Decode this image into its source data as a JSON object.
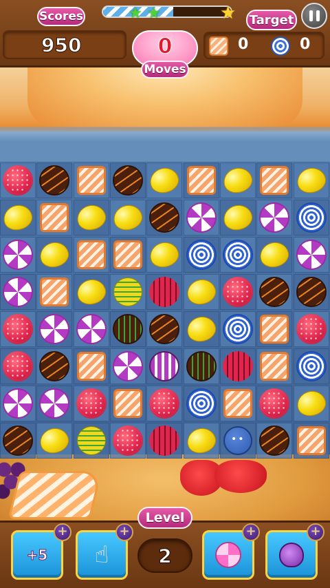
{
  "hud": {
    "scores_label": "Scores",
    "score_value": "950",
    "moves_value": "0",
    "moves_label": "Moves",
    "target_label": "Target",
    "progress_fraction": 0.55,
    "stars_earned": 2,
    "stars_total": 3,
    "targets": [
      {
        "icon": "toffee-candy-icon",
        "count": "0"
      },
      {
        "icon": "blue-swirl-candy-icon",
        "count": "0"
      }
    ]
  },
  "board": {
    "columns": 9,
    "empty_top_row": true,
    "grid": [
      [
        "raspberry",
        "chocolate",
        "toffee",
        "chocolate",
        "lemon",
        "toffee",
        "lemon",
        "toffee",
        "lemon"
      ],
      [
        "lemon",
        "toffee",
        "lemon",
        "lemon",
        "chocolate",
        "swirl",
        "lemon",
        "swirl",
        "blue"
      ],
      [
        "swirl",
        "lemon",
        "toffee",
        "toffee",
        "lemon",
        "blue",
        "blue",
        "lemon",
        "swirl"
      ],
      [
        "swirl",
        "toffee",
        "lemon",
        "lemon-striped",
        "raspberry-striped",
        "lemon",
        "raspberry",
        "chocolate",
        "chocolate"
      ],
      [
        "raspberry",
        "swirl",
        "swirl",
        "chocolate-striped",
        "chocolate",
        "lemon",
        "blue",
        "toffee",
        "raspberry"
      ],
      [
        "raspberry",
        "chocolate",
        "toffee",
        "swirl",
        "swirl-striped",
        "chocolate-striped",
        "raspberry-striped",
        "toffee",
        "blue"
      ],
      [
        "swirl",
        "swirl",
        "raspberry",
        "toffee",
        "raspberry",
        "blue",
        "toffee",
        "raspberry",
        "lemon"
      ],
      [
        "chocolate",
        "lemon",
        "lemon-striped",
        "raspberry",
        "raspberry-striped",
        "lemon",
        "bomb",
        "chocolate",
        "toffee"
      ]
    ]
  },
  "bottom": {
    "level_label": "Level",
    "level_value": "2",
    "boosters": [
      {
        "name": "plus5-moves-booster",
        "text": "+5",
        "plus": "+"
      },
      {
        "name": "hand-booster",
        "icon": "pointing-hand-icon",
        "plus": "+"
      },
      {
        "name": "lollipop-booster",
        "icon": "lollipop-icon",
        "plus": "+"
      },
      {
        "name": "potion-booster",
        "icon": "potion-icon",
        "plus": "+"
      }
    ]
  },
  "colors": {
    "accent_pink": "#b52a7c",
    "frame_brown": "#6b3814",
    "booster_blue": "#1b92d8",
    "booster_gold": "#ffd23f"
  }
}
